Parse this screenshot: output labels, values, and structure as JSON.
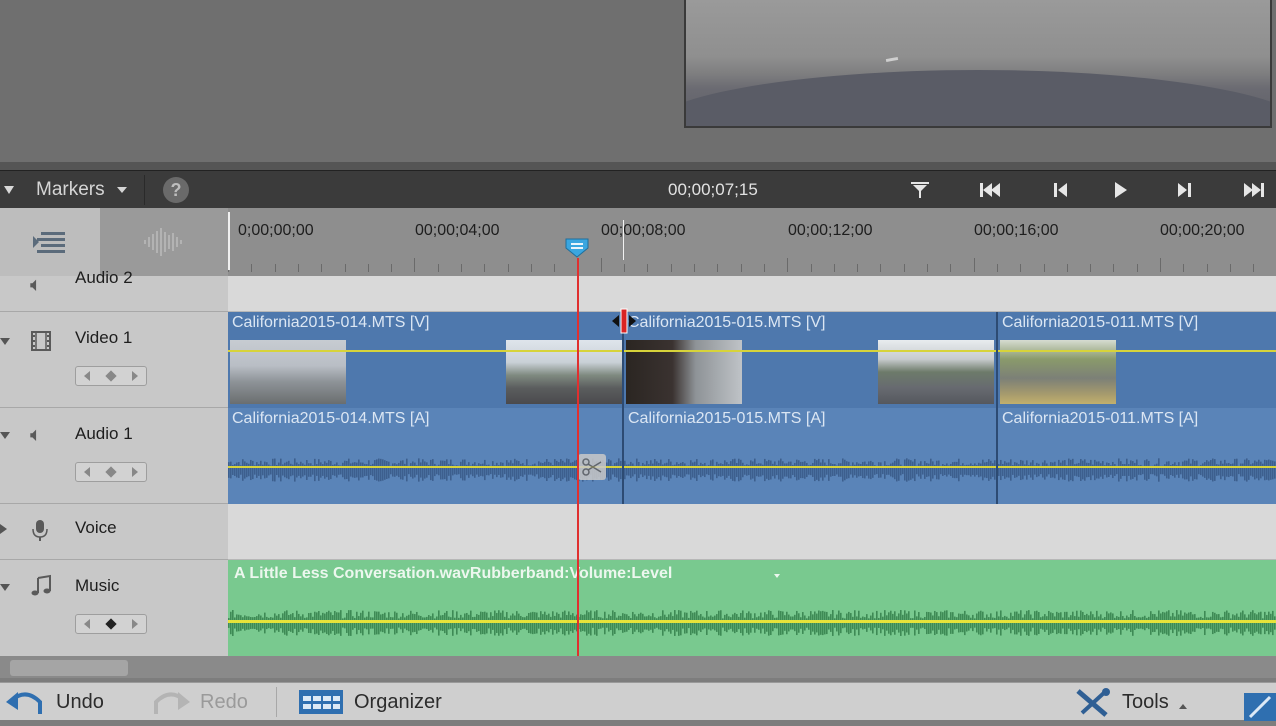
{
  "timeline_header": {
    "markers_label": "Markers",
    "help_symbol": "?",
    "timecode": "00;00;07;15"
  },
  "ruler": {
    "ticks": [
      "0;00;00;00",
      "00;00;04;00",
      "00;00;08;00",
      "00;00;12;00",
      "00;00;16;00",
      "00;00;20;00"
    ]
  },
  "tracks": {
    "audio2": {
      "name": "Audio 2"
    },
    "video1": {
      "name": "Video 1",
      "clips": [
        "California2015-014.MTS [V]",
        "California2015-015.MTS [V]",
        "California2015-011.MTS [V]"
      ]
    },
    "audio1": {
      "name": "Audio 1",
      "clips": [
        "California2015-014.MTS [A]",
        "California2015-015.MTS [A]",
        "California2015-011.MTS [A]"
      ]
    },
    "voice": {
      "name": "Voice"
    },
    "music": {
      "name": "Music",
      "clip": "A Little Less Conversation.wavRubberband:Volume:Level"
    }
  },
  "bottom_bar": {
    "undo": "Undo",
    "redo": "Redo",
    "organizer": "Organizer",
    "tools": "Tools"
  },
  "colors": {
    "video_clip": "#4e78ad",
    "audio_clip": "#5a84b8",
    "music_clip": "#79c98f",
    "playhead": "#e0302f",
    "rubberband": "#d7d33a"
  }
}
